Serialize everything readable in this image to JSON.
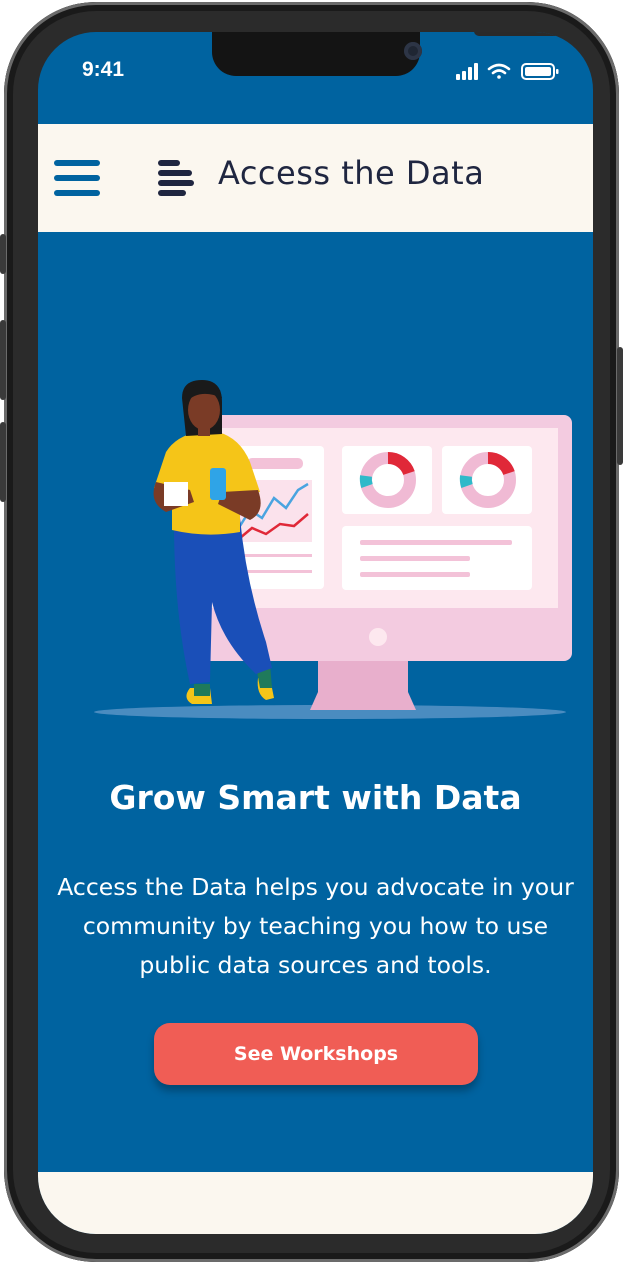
{
  "status_bar": {
    "time": "9:41"
  },
  "header": {
    "brand_name": "Access the Data"
  },
  "hero": {
    "title": "Grow Smart with Data",
    "description": "Access the Data helps you advocate in your community by teaching you how to use public data sources and tools.",
    "cta_label": "See Workshops"
  },
  "colors": {
    "primary_blue": "#0063a0",
    "cream": "#fbf7ef",
    "cta_red": "#f05d55",
    "brand_text": "#1f2640"
  }
}
